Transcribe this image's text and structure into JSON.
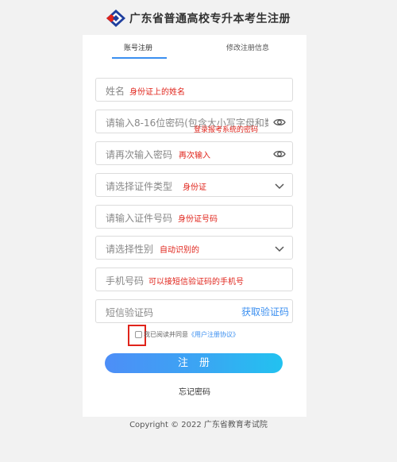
{
  "header": {
    "title": "广东省普通高校专升本考生注册",
    "logo_icon": "diamond-logo-icon"
  },
  "tabs": [
    {
      "label": "账号注册",
      "active": true
    },
    {
      "label": "修改注册信息",
      "active": false
    }
  ],
  "form": {
    "name": {
      "placeholder": "姓名",
      "annotation": "身份证上的姓名"
    },
    "password": {
      "placeholder": "请输入8-16位密码(包含大小写字母和数字)",
      "annotation": "登录报考系统的密码",
      "icon": "eye-icon"
    },
    "password_confirm": {
      "placeholder": "请再次输入密码",
      "annotation": "再次输入",
      "icon": "eye-icon"
    },
    "id_type": {
      "placeholder": "请选择证件类型",
      "annotation": "身份证",
      "icon": "chevron-down-icon"
    },
    "id_number": {
      "placeholder": "请输入证件号码",
      "annotation": "身份证号码"
    },
    "gender": {
      "placeholder": "请选择性别",
      "annotation": "自动识别的",
      "icon": "chevron-down-icon"
    },
    "phone": {
      "placeholder": "手机号码",
      "annotation": "可以接短信验证码的手机号"
    },
    "sms_code": {
      "placeholder": "短信验证码",
      "button": "获取验证码"
    }
  },
  "agreement": {
    "text": "我已阅读并同意",
    "link": "《用户注册协议》",
    "checked": false
  },
  "actions": {
    "register": "注册",
    "forgot_password": "忘记密码"
  },
  "footer": {
    "copyright": "Copyright © 2022 广东省教育考试院"
  },
  "colors": {
    "accent": "#3b8ff0",
    "annotation_red": "#e0241b",
    "page_bg": "#f2f2f2"
  }
}
